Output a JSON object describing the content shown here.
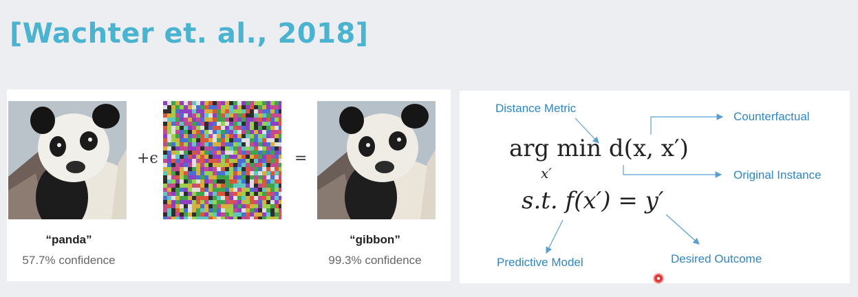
{
  "slide": {
    "title": "[Wachter et. al., 2018]"
  },
  "adversarial_example": {
    "plus_epsilon": "+ϵ",
    "equals": "=",
    "original": {
      "name": "“panda”",
      "confidence": "57.7% confidence"
    },
    "perturbed": {
      "name": "“gibbon”",
      "confidence": "99.3% confidence"
    }
  },
  "formula": {
    "objective": "arg min d(x, x′)",
    "objective_sub": "x′",
    "constraint": "s.t.  f(x′) = y′",
    "labels": {
      "distance_metric": "Distance Metric",
      "counterfactual": "Counterfactual",
      "original_instance": "Original Instance",
      "predictive_model": "Predictive Model",
      "desired_outcome": "Desired Outcome"
    }
  },
  "colors": {
    "title": "#4ab3cf",
    "annotation": "#2f86c4"
  }
}
